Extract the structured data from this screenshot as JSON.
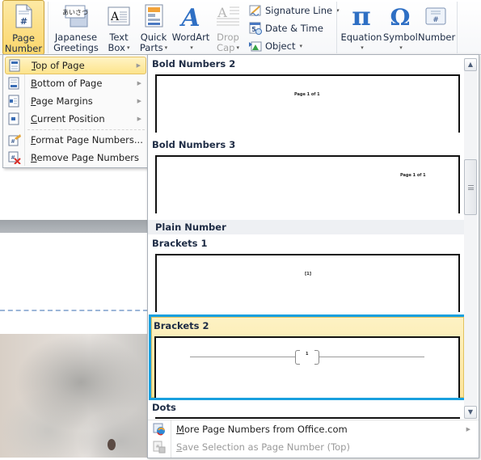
{
  "ribbon": {
    "page_number": {
      "line1": "Page",
      "line2": "Number",
      "icon": "page-number-icon"
    },
    "japanese_greetings": {
      "line1": "Japanese",
      "line2": "Greetings",
      "icon_text": "あいさつ"
    },
    "text_box": {
      "line1": "Text",
      "line2": "Box"
    },
    "quick_parts": {
      "line1": "Quick",
      "line2": "Parts"
    },
    "wordart": {
      "line1": "WordArt",
      "glyph": "A"
    },
    "drop_cap": {
      "line1": "Drop",
      "line2": "Cap"
    },
    "signature_line": "Signature Line",
    "date_time": "Date & Time",
    "object": "Object",
    "equation": {
      "label": "Equation",
      "glyph": "π"
    },
    "symbol": {
      "label": "Symbol",
      "glyph": "Ω"
    },
    "number": {
      "label": "Number",
      "glyph": "#"
    },
    "caret": "▾"
  },
  "page_number_menu": {
    "items": [
      {
        "label_u": "T",
        "label_rest": "op of Page",
        "has_submenu": true,
        "highlighted": true
      },
      {
        "label_u": "B",
        "label_rest": "ottom of Page",
        "has_submenu": true
      },
      {
        "label_u": "P",
        "label_rest": "age Margins",
        "has_submenu": true
      },
      {
        "label_u": "C",
        "label_rest": "urrent Position",
        "has_submenu": true
      },
      {
        "label_u": "F",
        "label_rest": "ormat Page Numbers...",
        "has_submenu": false
      },
      {
        "label_u": "R",
        "label_rest": "emove Page Numbers",
        "has_submenu": false
      }
    ],
    "arrow": "▶"
  },
  "gallery": {
    "items": [
      {
        "title": "Bold Numbers 2",
        "preview_text": "Page 1 of 1"
      },
      {
        "title": "Bold Numbers 3",
        "preview_text": "Page 1 of 1"
      },
      {
        "title": "Brackets 1",
        "preview_text": "[1]"
      },
      {
        "title": "Brackets 2",
        "preview_text": "1",
        "selected": true
      },
      {
        "title": "Dots"
      }
    ],
    "category": "Plain Number",
    "scroll_up": "▲",
    "scroll_down": "▼",
    "more_label_u": "M",
    "more_label_rest": "ore Page Numbers from Office.com",
    "save_label_u": "S",
    "save_label_rest": "ave Selection as Page Number (Top)",
    "arrow": "▶"
  },
  "colors": {
    "selection_border": "#19a0de",
    "highlight": "#fde48c",
    "ribbon_text": "#1e2c45"
  }
}
